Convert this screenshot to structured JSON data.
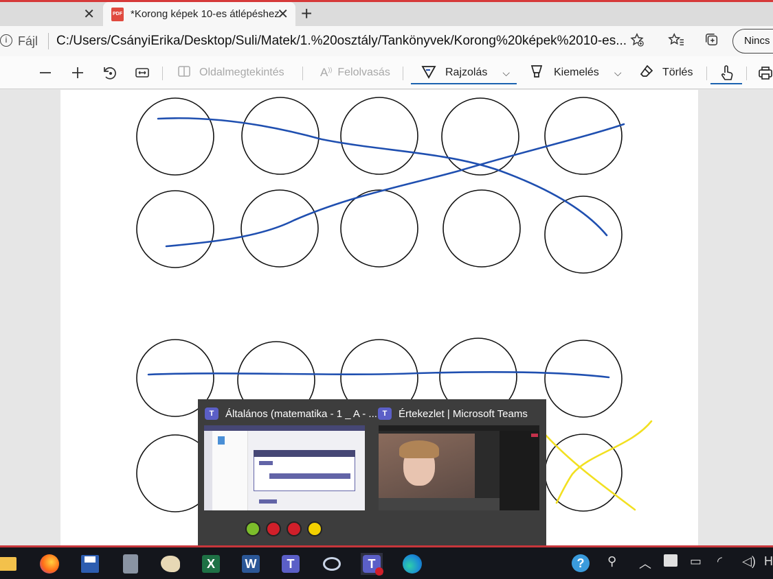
{
  "tabs": [
    {
      "title": "",
      "close": "✕"
    },
    {
      "title": "*Korong képek 10-es átlépéshez",
      "close": "✕",
      "active": true
    }
  ],
  "new_tab": "+",
  "address": {
    "prefix": "Fájl",
    "url": "C:/Users/CsányiErika/Desktop/Suli/Matek/1.%20osztály/Tankönyvek/Korong%20képek%2010-es...",
    "profile_button": "Nincs s"
  },
  "pdf_toolbar": {
    "page_view": "Oldalmegtekintés",
    "read_aloud": "Felolvasás",
    "draw": "Rajzolás",
    "highlight": "Kiemelés",
    "erase": "Törlés"
  },
  "drawing": {
    "ink_color_blue": "#1f4fb0",
    "ink_color_yellow": "#f2e021"
  },
  "taskbar_preview": {
    "window1_title": "Általános (matematika - 1 _ A - ...",
    "window2_title": "Értekezlet | Microsoft Teams",
    "status_colors": [
      "#7cbd2b",
      "#d11f2a",
      "#d11f2a",
      "#f2d000"
    ]
  },
  "taskbar": {
    "apps": [
      "file-explorer",
      "firefox",
      "save",
      "calculator",
      "paint",
      "excel",
      "word",
      "teams",
      "snip",
      "teams-meeting",
      "edge"
    ]
  },
  "colors": {
    "accent": "#1a62b0",
    "taskbar_bg": "#14161c",
    "red_border": "#c8363b"
  }
}
